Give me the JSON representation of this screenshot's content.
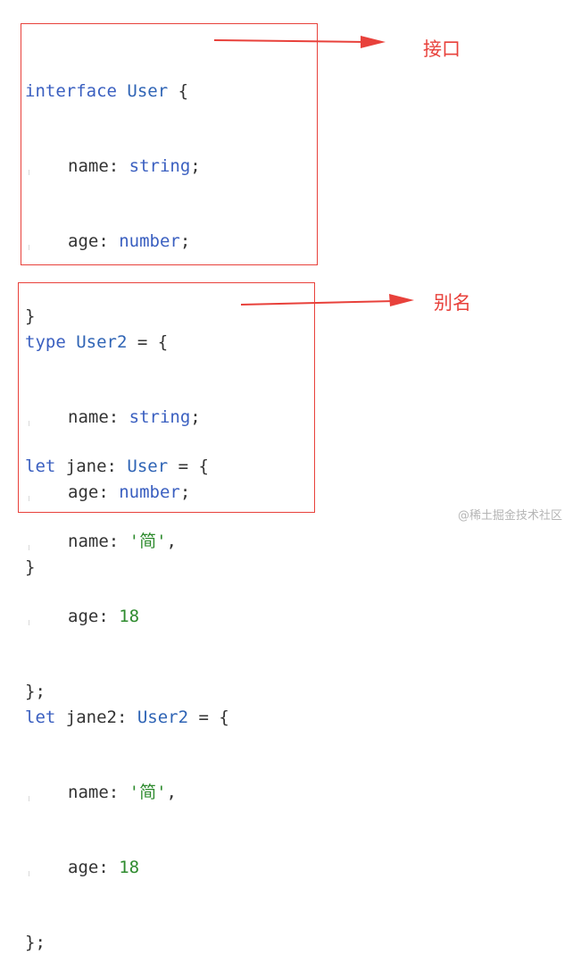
{
  "colors": {
    "annotation": "#e8413b",
    "keyword": "#3a5fc0",
    "type": "#2f64b5",
    "string": "#2e8b2e",
    "number": "#2e8b2e",
    "punctuation": "#333333"
  },
  "block1": {
    "l1": {
      "kw": "interface",
      "name": " User",
      "rest": " {"
    },
    "l2": {
      "key": "name:",
      "type": " string",
      "end": ";"
    },
    "l3": {
      "key": "age:",
      "type": " number",
      "end": ";"
    },
    "l4": "}",
    "l6": {
      "kw": "let",
      "name": " jane:",
      "type": " User",
      "rest": " = {"
    },
    "l7": {
      "key": "name:",
      "val": " '简'",
      "end": ","
    },
    "l8": {
      "key": "age:",
      "val": " 18"
    },
    "l9": "};"
  },
  "block2": {
    "l1": {
      "kw": "type",
      "name": " User2",
      "rest": " = {"
    },
    "l2": {
      "key": "name:",
      "type": " string",
      "end": ";"
    },
    "l3": {
      "key": "age:",
      "type": " number",
      "end": ";"
    },
    "l4": "}",
    "l6": {
      "kw": "let",
      "name": " jane2:",
      "type": " User2",
      "rest": " = {"
    },
    "l7": {
      "key": "name:",
      "val": " '简'",
      "end": ","
    },
    "l8": {
      "key": "age:",
      "val": " 18"
    },
    "l9": "};"
  },
  "annotations": {
    "interface_label": "接口",
    "alias_label": "别名"
  },
  "watermark": "@稀土掘金技术社区"
}
